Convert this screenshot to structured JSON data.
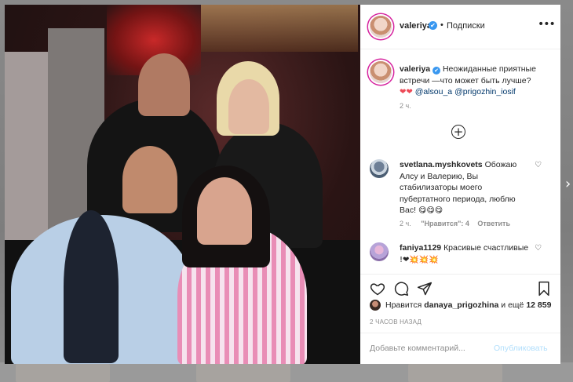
{
  "post": {
    "header": {
      "username": "valeriya",
      "verified_glyph": "✔",
      "separator": "•",
      "follow_label": "Подписки",
      "more_icon": "more-options-icon"
    },
    "caption": {
      "username": "valeriya",
      "text": "Неожиданные приятные встречи —что может быть лучше?",
      "hearts": "❤❤",
      "mention_1": "@alsou_a",
      "mention_2": "@prigozhin_iosif",
      "time": "2 ч."
    },
    "load_more_glyph": "+",
    "comments": [
      {
        "username": "svetlana.myshkovets",
        "text": "Обожаю Алсу и Валерию, Вы стабилизаторы моего пубертатного периода, люблю Вас!",
        "emoji": "😋😋😋",
        "time": "2 ч.",
        "likes": "\"Нравится\": 4",
        "reply_label": "Ответить"
      },
      {
        "username": "faniya1129",
        "text": "Красивые счастливые",
        "emoji": "!❤💥💥💥"
      }
    ],
    "likes": {
      "prefix": "Нравится",
      "user": "danaya_prigozhina",
      "suffix": "и ещё",
      "count": "12 859"
    },
    "date": "2 ЧАСОВ НАЗАД",
    "comment_input": {
      "placeholder": "Добавьте комментарий...",
      "post_label": "Опубликовать"
    }
  },
  "nav": {
    "next_glyph": "›"
  },
  "colors": {
    "link_blue": "#00376b",
    "verified_blue": "#3897f0",
    "heart_red": "#ed4956",
    "muted_gray": "#8e8e8e",
    "post_disabled_blue": "#b2dffc"
  }
}
